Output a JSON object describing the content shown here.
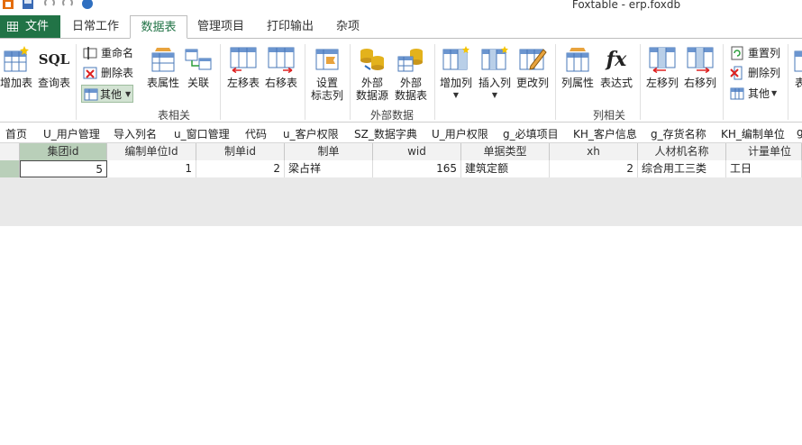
{
  "window": {
    "title": "Foxtable - erp.foxdb"
  },
  "tabs": {
    "file": "文件",
    "items": [
      "日常工作",
      "数据表",
      "管理项目",
      "打印输出",
      "杂项"
    ],
    "active": "数据表"
  },
  "ribbon": {
    "table_group": {
      "label": "表相关",
      "add_table": "增加表",
      "query_table": "查询表",
      "sql_icon": "SQL",
      "rename": "重命名",
      "delete_table": "删除表",
      "other": "其他",
      "table_props": "表属性",
      "link": "关联",
      "move_left_table": "左移表",
      "move_right_table": "右移表",
      "set_flag_col": [
        "设置",
        "标志列"
      ]
    },
    "external_group": {
      "label": "外部数据",
      "ext_source": [
        "外部",
        "数据源"
      ],
      "ext_table": [
        "外部",
        "数据表"
      ]
    },
    "column_group": {
      "label": "列相关",
      "add_col": "增加列",
      "insert_col": "插入列",
      "change_col": "更改列",
      "col_props": "列属性",
      "expression": "表达式",
      "fx_icon": "fx",
      "move_left_col": "左移列",
      "move_right_col": "右移列",
      "reset_col": "重置列",
      "delete_col": "删除列",
      "other": "其他",
      "cut_label": "表"
    }
  },
  "sheet_tabs": [
    "首页",
    "U_用户管理",
    "导入列名",
    "u_窗口管理",
    "代码",
    "u_客户权限",
    "SZ_数据字典",
    "U_用户权限",
    "g_必填项目",
    "KH_客户信息",
    "g_存货名称",
    "KH_编制单位",
    "g"
  ],
  "grid": {
    "columns": [
      "集团id",
      "编制单位Id",
      "制单id",
      "制单",
      "wid",
      "单据类型",
      "xh",
      "人材机名称",
      "计量单位"
    ],
    "rows": [
      [
        "5",
        "1",
        "2",
        "梁占祥",
        "165",
        "建筑定额",
        "2",
        "综合用工三类",
        "工日"
      ]
    ]
  },
  "colors": {
    "accent": "#217346",
    "selected_header": "#b9cfb9"
  }
}
